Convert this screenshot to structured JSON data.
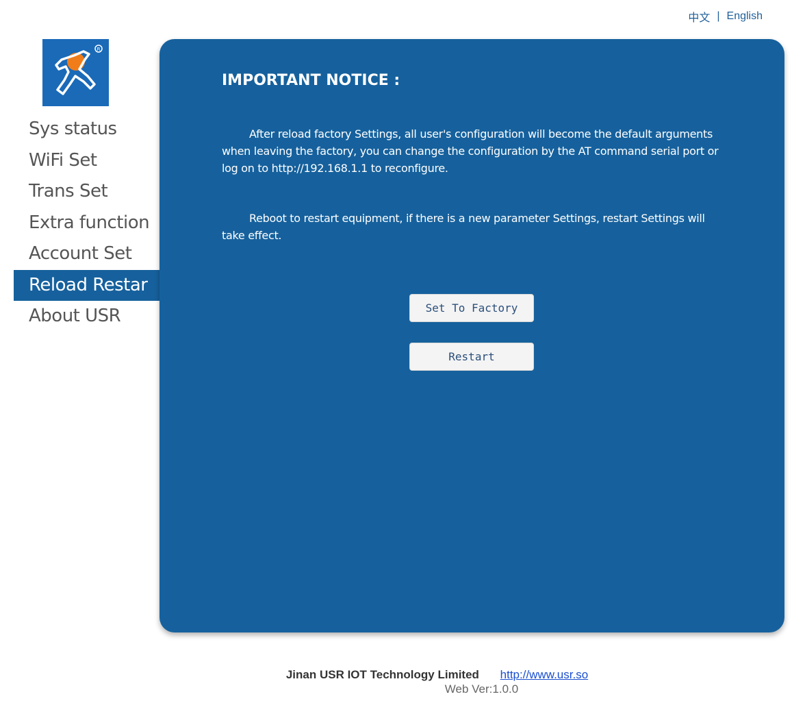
{
  "header": {
    "lang_zh": "中文",
    "lang_separator": "|",
    "lang_en": "English"
  },
  "logo": {
    "icon": "usr-runner-logo-icon",
    "bg_color": "#1a6ab8",
    "accent_color": "#f07d1a"
  },
  "sidebar": {
    "items": [
      {
        "label": "Sys status"
      },
      {
        "label": "WiFi Set"
      },
      {
        "label": "Trans Set"
      },
      {
        "label": "Extra function"
      },
      {
        "label": "Account Set"
      },
      {
        "label": "Reload Restar"
      },
      {
        "label": "About USR"
      }
    ],
    "active": "Reload Restar"
  },
  "main": {
    "title": "IMPORTANT NOTICE :",
    "paragraph1": "After reload factory Settings, all user's configuration will become the default arguments when leaving the factory, you can change the configuration by the AT command serial port or log on to http://192.168.1.1 to reconfigure.",
    "paragraph2": "Reboot to restart equipment, if there is a new parameter Settings, restart Settings will take effect.",
    "factory_button": "Set To Factory",
    "restart_button": "Restart",
    "panel_color": "#16619d"
  },
  "footer": {
    "company": "Jinan USR IOT Technology Limited",
    "link": "http://www.usr.so",
    "version": "Web Ver:1.0.0"
  }
}
